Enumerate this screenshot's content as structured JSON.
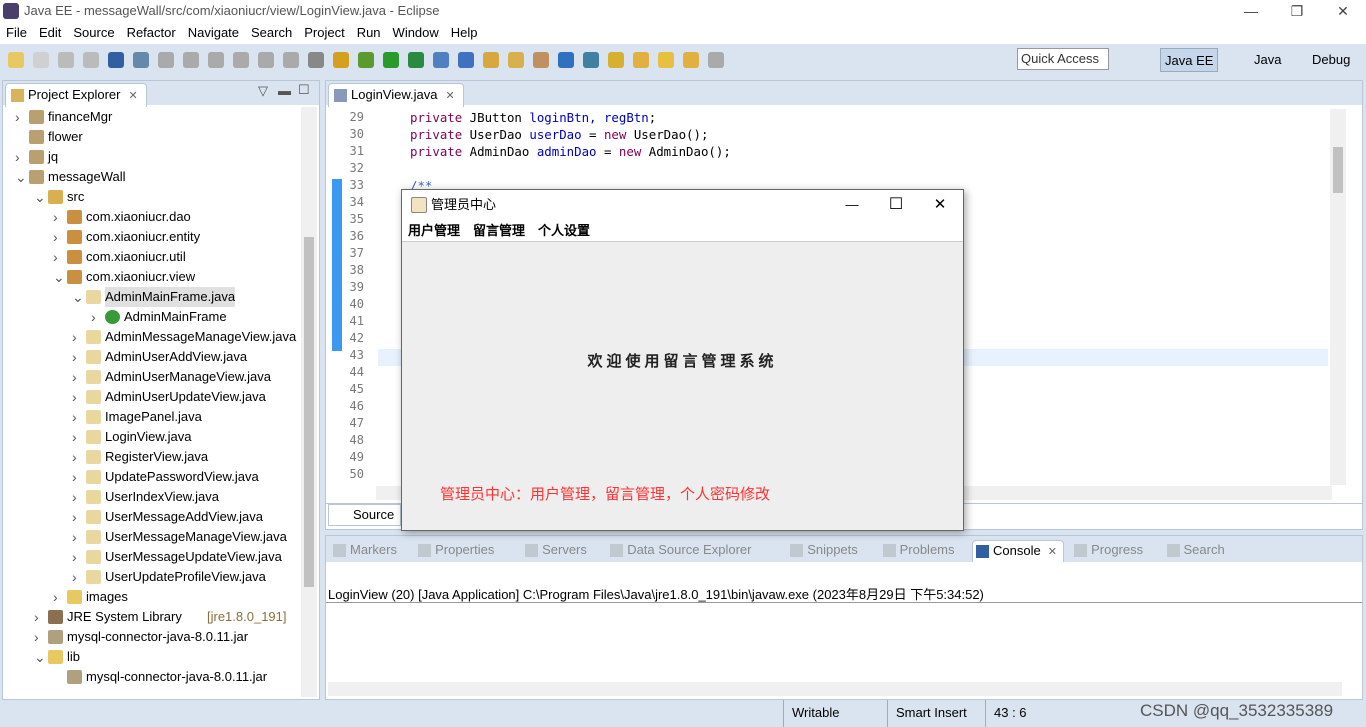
{
  "window": {
    "title": "Java EE - messageWall/src/com/xiaoniucr/view/LoginView.java - Eclipse",
    "minimize": "—",
    "maximize": "❐",
    "close": "✕"
  },
  "menu": [
    "File",
    "Edit",
    "Source",
    "Refactor",
    "Navigate",
    "Search",
    "Project",
    "Run",
    "Window",
    "Help"
  ],
  "toolbar": {
    "quick_access": "Quick Access",
    "perspectives": [
      "Java EE",
      "Java",
      "Debug"
    ]
  },
  "explorer": {
    "tab": "Project Explorer",
    "items": [
      {
        "label": "financeMgr",
        "level": 0,
        "open": false,
        "icon": "project"
      },
      {
        "label": "flower",
        "level": 0,
        "open": null,
        "icon": "project"
      },
      {
        "label": "jq",
        "level": 0,
        "open": false,
        "icon": "project"
      },
      {
        "label": "messageWall",
        "level": 0,
        "open": true,
        "icon": "project"
      },
      {
        "label": "src",
        "level": 1,
        "open": true,
        "icon": "source-folder"
      },
      {
        "label": "com.xiaoniucr.dao",
        "level": 2,
        "open": false,
        "icon": "package"
      },
      {
        "label": "com.xiaoniucr.entity",
        "level": 2,
        "open": false,
        "icon": "package"
      },
      {
        "label": "com.xiaoniucr.util",
        "level": 2,
        "open": false,
        "icon": "package"
      },
      {
        "label": "com.xiaoniucr.view",
        "level": 2,
        "open": true,
        "icon": "package"
      },
      {
        "label": "AdminMainFrame.java",
        "level": 3,
        "open": true,
        "icon": "java-file",
        "selected": true
      },
      {
        "label": "AdminMainFrame",
        "level": 4,
        "open": false,
        "icon": "class"
      },
      {
        "label": "AdminMessageManageView.java",
        "level": 3,
        "open": false,
        "icon": "java-file"
      },
      {
        "label": "AdminUserAddView.java",
        "level": 3,
        "open": false,
        "icon": "java-file"
      },
      {
        "label": "AdminUserManageView.java",
        "level": 3,
        "open": false,
        "icon": "java-file"
      },
      {
        "label": "AdminUserUpdateView.java",
        "level": 3,
        "open": false,
        "icon": "java-file"
      },
      {
        "label": "ImagePanel.java",
        "level": 3,
        "open": false,
        "icon": "java-file"
      },
      {
        "label": "LoginView.java",
        "level": 3,
        "open": false,
        "icon": "java-file"
      },
      {
        "label": "RegisterView.java",
        "level": 3,
        "open": false,
        "icon": "java-file"
      },
      {
        "label": "UpdatePasswordView.java",
        "level": 3,
        "open": false,
        "icon": "java-file"
      },
      {
        "label": "UserIndexView.java",
        "level": 3,
        "open": false,
        "icon": "java-file"
      },
      {
        "label": "UserMessageAddView.java",
        "level": 3,
        "open": false,
        "icon": "java-file"
      },
      {
        "label": "UserMessageManageView.java",
        "level": 3,
        "open": false,
        "icon": "java-file"
      },
      {
        "label": "UserMessageUpdateView.java",
        "level": 3,
        "open": false,
        "icon": "java-file"
      },
      {
        "label": "UserUpdateProfileView.java",
        "level": 3,
        "open": false,
        "icon": "java-file"
      },
      {
        "label": "images",
        "level": 2,
        "open": false,
        "icon": "folder"
      },
      {
        "label": "JRE System Library",
        "suffix": "[jre1.8.0_191]",
        "level": 1,
        "open": false,
        "icon": "library"
      },
      {
        "label": "mysql-connector-java-8.0.11.jar",
        "level": 1,
        "open": false,
        "icon": "jar"
      },
      {
        "label": "lib",
        "level": 1,
        "open": true,
        "icon": "folder"
      },
      {
        "label": "mysql-connector-java-8.0.11.jar",
        "level": 2,
        "open": null,
        "icon": "jar"
      }
    ]
  },
  "editor": {
    "tab": "LoginView.java",
    "source_tab": "Source",
    "line_numbers": [
      "29",
      "30",
      "31",
      "32",
      "33",
      "34",
      "35",
      "36",
      "37",
      "38",
      "39",
      "40",
      "41",
      "42",
      "43",
      "44",
      "45",
      "46",
      "47",
      "48",
      "49",
      "50"
    ],
    "code": {
      "l29": {
        "k": "private",
        "t": " JButton ",
        "f": "loginBtn, regBtn",
        ";": ";"
      },
      "l30": {
        "k": "private",
        "t": " UserDao ",
        "f": "userDao",
        "e": " = ",
        "n": "new",
        "r": " UserDao();"
      },
      "l31": {
        "k": "private",
        "t": " AdminDao ",
        "f": "adminDao",
        "e": " = ",
        "n": "new",
        "r": " AdminDao();"
      },
      "l33": "/**"
    },
    "cursor_line": "43"
  },
  "bottom": {
    "tabs": [
      "Markers",
      "Properties",
      "Servers",
      "Data Source Explorer",
      "Snippets",
      "Problems",
      "Console",
      "Progress",
      "Search"
    ],
    "active": "Console",
    "console_header": "LoginView (20) [Java Application] C:\\Program Files\\Java\\jre1.8.0_191\\bin\\javaw.exe (2023年8月29日 下午5:34:52)"
  },
  "status": {
    "writable": "Writable",
    "insert": "Smart Insert",
    "position": "43 : 6",
    "watermark": "CSDN @qq_3532335389"
  },
  "dialog": {
    "title": "管理员中心",
    "menu": [
      "用户管理",
      "留言管理",
      "个人设置"
    ],
    "welcome": "欢迎使用留言管理系统",
    "description": "管理员中心：用户管理，留言管理，个人密码修改",
    "description_color": "#ff3333",
    "minimize": "—",
    "maximize": "☐",
    "close": "✕"
  }
}
